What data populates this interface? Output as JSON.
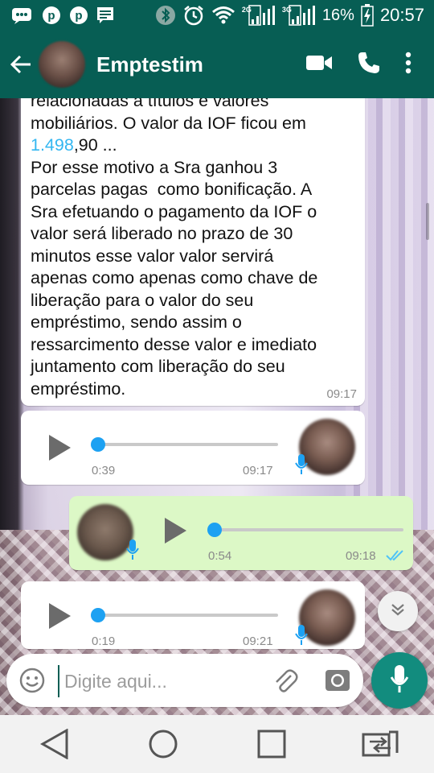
{
  "status_bar": {
    "battery_percent": "16%",
    "time": "20:57",
    "net1": "2G",
    "net2": "3G",
    "icons": [
      "whatsapp-icon",
      "pinterest-icon",
      "pinterest-icon",
      "message-icon",
      "bluetooth-icon",
      "alarm-icon",
      "wifi-icon",
      "signal-icon",
      "signal-icon",
      "battery-icon"
    ]
  },
  "header": {
    "contact_name": "Emptestim",
    "icons": [
      "back-arrow-icon",
      "video-call-icon",
      "phone-icon",
      "more-vert-icon"
    ]
  },
  "messages": {
    "text_partial_top": "relacionadas a títulos e valores",
    "text_line_2": "mobiliários. O valor da IOF ficou em",
    "text_amount_link": "1.498",
    "text_amount_rest": ",90 ...",
    "text_body": "Por esse motivo a Sra ganhou 3\nparcelas pagas  como bonificação. A\nSra efetuando o pagamento da IOF o\nvalor será liberado no prazo de 30\nminutos esse valor valor servirá\napenas como apenas como chave de\nliberação para o valor do seu\nempréstimo, sendo assim o\nressarcimento desse valor e imediato\njuntamento com liberação do seu\nempréstimo.",
    "text_time": "09:17",
    "voice_1": {
      "duration": "0:39",
      "time": "09:17",
      "progress": 0
    },
    "voice_2": {
      "duration": "0:54",
      "time": "09:18",
      "progress": 0,
      "status": "read"
    },
    "voice_3": {
      "duration": "0:19",
      "time": "09:21",
      "progress": 0
    }
  },
  "composer": {
    "placeholder": "Digite aqui..."
  },
  "colors": {
    "header": "#075e54",
    "accent": "#128c7e",
    "outgoing_bubble": "#dcf8c6",
    "link": "#34b7f1",
    "read_ticks": "#4fc3f7"
  }
}
